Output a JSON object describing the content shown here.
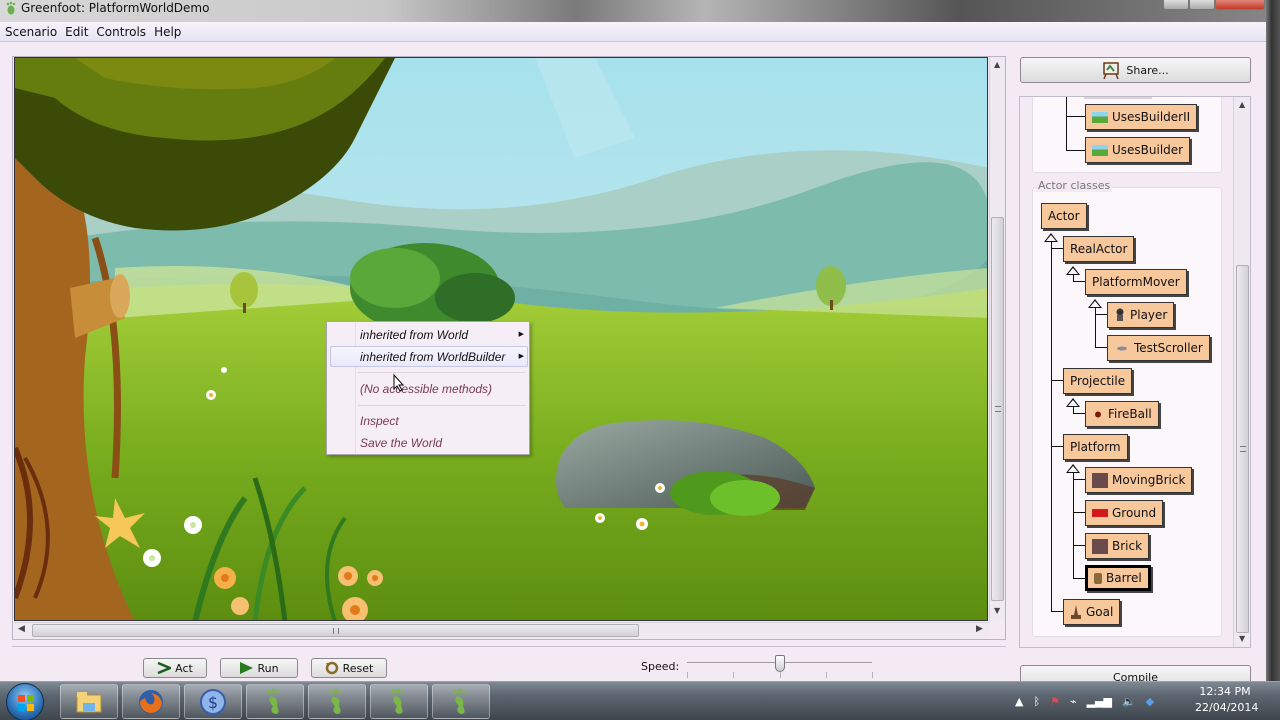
{
  "window": {
    "title": "Greenfoot: PlatformWorldDemo"
  },
  "menubar": {
    "items": [
      "Scenario",
      "Edit",
      "Controls",
      "Help"
    ]
  },
  "context_menu": {
    "items": [
      {
        "label": "inherited from World",
        "has_submenu": true
      },
      {
        "label": "inherited from WorldBuilder",
        "has_submenu": true,
        "highlighted": true
      },
      {
        "label": "(No accessible methods)",
        "disabled": true
      },
      {
        "label": "Inspect"
      },
      {
        "label": "Save the World"
      }
    ],
    "arrow_glyph": "▶"
  },
  "controls": {
    "act_label": "Act",
    "run_label": "Run",
    "reset_label": "Reset",
    "speed_label": "Speed:",
    "speed_value_fraction": 0.5
  },
  "right_panel": {
    "share_label": "Share...",
    "world_classes": [
      {
        "name": "UsesBuilderII",
        "icon": "landscape-icon"
      },
      {
        "name": "UsesBuilder",
        "icon": "landscape-icon"
      }
    ],
    "actor_classes_title": "Actor classes",
    "actor_classes": {
      "actor": "Actor",
      "real_actor": "RealActor",
      "platform_mover": "PlatformMover",
      "player": "Player",
      "test_scroller": "TestScroller",
      "projectile": "Projectile",
      "fireball": "FireBall",
      "platform": "Platform",
      "moving_brick": "MovingBrick",
      "ground": "Ground",
      "brick": "Brick",
      "barrel": "Barrel",
      "goal": "Goal"
    },
    "selected_class": "Barrel",
    "compile_label": "Compile"
  },
  "taskbar": {
    "apps": [
      "start-button",
      "file-explorer",
      "firefox",
      "sync-app",
      "greenfoot",
      "greenfoot",
      "greenfoot",
      "greenfoot"
    ],
    "time": "12:34 PM",
    "date": "22/04/2014"
  },
  "colors": {
    "class_box": "#f8c89d",
    "panel_bg": "#f3eaf4",
    "menu_disabled_text": "#7a3a50"
  }
}
